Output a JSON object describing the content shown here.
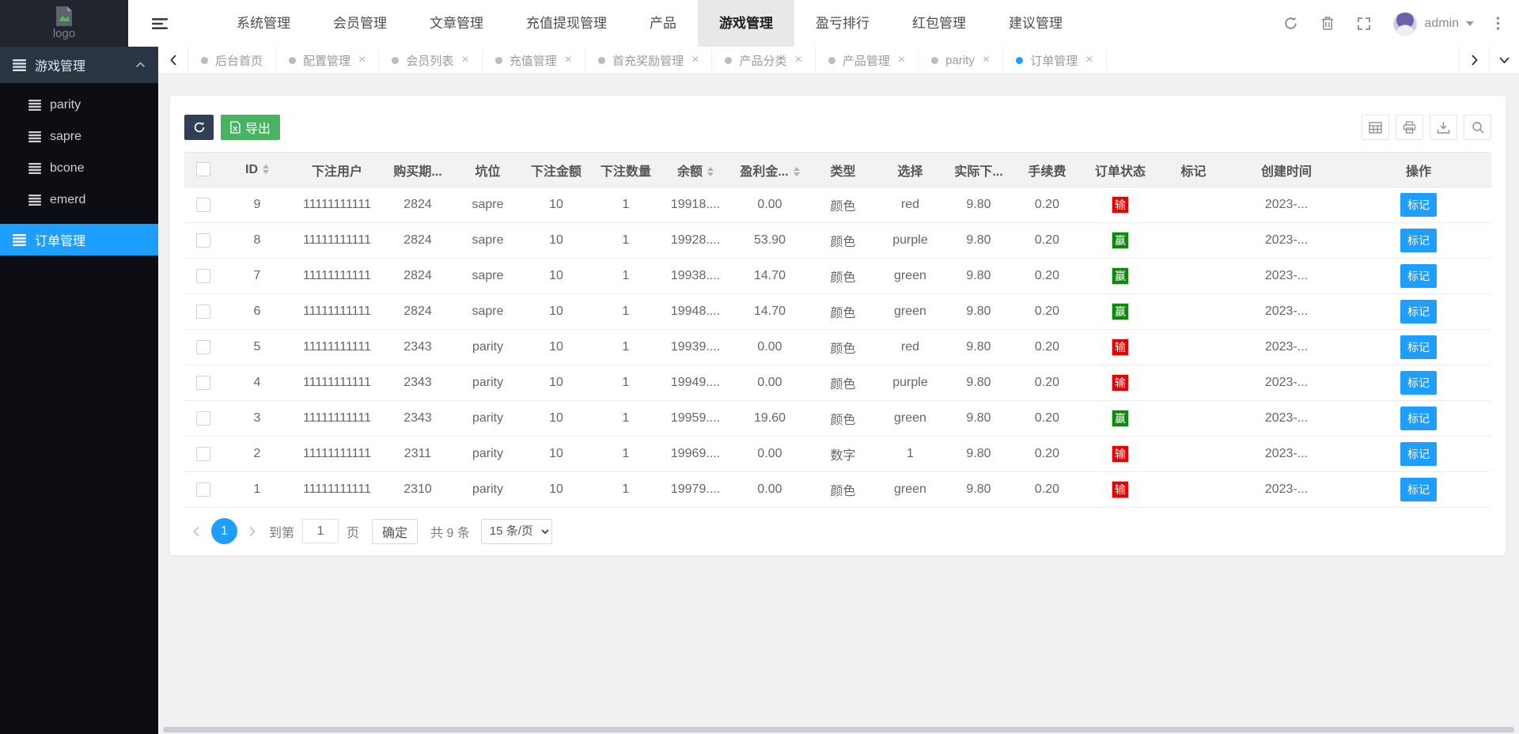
{
  "header": {
    "logo_text": "logo",
    "nav_items": [
      "系统管理",
      "会员管理",
      "文章管理",
      "充值提现管理",
      "产品",
      "游戏管理",
      "盈亏排行",
      "红包管理",
      "建议管理"
    ],
    "active_nav_index": 5,
    "username": "admin"
  },
  "tabbar": {
    "tabs": [
      {
        "label": "后台首页",
        "closable": false,
        "active": false
      },
      {
        "label": "配置管理",
        "closable": true,
        "active": false
      },
      {
        "label": "会员列表",
        "closable": true,
        "active": false
      },
      {
        "label": "充值管理",
        "closable": true,
        "active": false
      },
      {
        "label": "首充奖励管理",
        "closable": true,
        "active": false
      },
      {
        "label": "产品分类",
        "closable": true,
        "active": false
      },
      {
        "label": "产品管理",
        "closable": true,
        "active": false
      },
      {
        "label": "parity",
        "closable": true,
        "active": false
      },
      {
        "label": "订单管理",
        "closable": true,
        "active": true
      }
    ]
  },
  "sidebar": {
    "group_label": "游戏管理",
    "items": [
      "parity",
      "sapre",
      "bcone",
      "emerd"
    ],
    "active_item": "订单管理"
  },
  "toolbar": {
    "export_label": "导出"
  },
  "table": {
    "columns": [
      {
        "label": "ID",
        "sortable": true
      },
      {
        "label": "下注用户",
        "sortable": false
      },
      {
        "label": "购买期...",
        "sortable": false
      },
      {
        "label": "坑位",
        "sortable": false
      },
      {
        "label": "下注金额",
        "sortable": false
      },
      {
        "label": "下注数量",
        "sortable": false
      },
      {
        "label": "余额",
        "sortable": true
      },
      {
        "label": "盈利金...",
        "sortable": true
      },
      {
        "label": "类型",
        "sortable": false
      },
      {
        "label": "选择",
        "sortable": false
      },
      {
        "label": "实际下...",
        "sortable": false
      },
      {
        "label": "手续费",
        "sortable": false
      },
      {
        "label": "订单状态",
        "sortable": false
      },
      {
        "label": "标记",
        "sortable": false
      },
      {
        "label": "创建时间",
        "sortable": false
      },
      {
        "label": "操作",
        "sortable": false
      }
    ],
    "action_label": "标记",
    "rows": [
      {
        "id": "9",
        "user": "11111111111",
        "period": "2824",
        "slot": "sapre",
        "amount": "10",
        "qty": "1",
        "balance": "19918....",
        "profit": "0.00",
        "type": "颜色",
        "choice": "red",
        "actual": "9.80",
        "fee": "0.20",
        "status": "输",
        "status_type": "lose",
        "mark": "",
        "created": "2023-..."
      },
      {
        "id": "8",
        "user": "11111111111",
        "period": "2824",
        "slot": "sapre",
        "amount": "10",
        "qty": "1",
        "balance": "19928....",
        "profit": "53.90",
        "type": "颜色",
        "choice": "purple",
        "actual": "9.80",
        "fee": "0.20",
        "status": "赢",
        "status_type": "win",
        "mark": "",
        "created": "2023-..."
      },
      {
        "id": "7",
        "user": "11111111111",
        "period": "2824",
        "slot": "sapre",
        "amount": "10",
        "qty": "1",
        "balance": "19938....",
        "profit": "14.70",
        "type": "颜色",
        "choice": "green",
        "actual": "9.80",
        "fee": "0.20",
        "status": "赢",
        "status_type": "win",
        "mark": "",
        "created": "2023-..."
      },
      {
        "id": "6",
        "user": "11111111111",
        "period": "2824",
        "slot": "sapre",
        "amount": "10",
        "qty": "1",
        "balance": "19948....",
        "profit": "14.70",
        "type": "颜色",
        "choice": "green",
        "actual": "9.80",
        "fee": "0.20",
        "status": "赢",
        "status_type": "win",
        "mark": "",
        "created": "2023-..."
      },
      {
        "id": "5",
        "user": "11111111111",
        "period": "2343",
        "slot": "parity",
        "amount": "10",
        "qty": "1",
        "balance": "19939....",
        "profit": "0.00",
        "type": "颜色",
        "choice": "red",
        "actual": "9.80",
        "fee": "0.20",
        "status": "输",
        "status_type": "lose",
        "mark": "",
        "created": "2023-..."
      },
      {
        "id": "4",
        "user": "11111111111",
        "period": "2343",
        "slot": "parity",
        "amount": "10",
        "qty": "1",
        "balance": "19949....",
        "profit": "0.00",
        "type": "颜色",
        "choice": "purple",
        "actual": "9.80",
        "fee": "0.20",
        "status": "输",
        "status_type": "lose",
        "mark": "",
        "created": "2023-..."
      },
      {
        "id": "3",
        "user": "11111111111",
        "period": "2343",
        "slot": "parity",
        "amount": "10",
        "qty": "1",
        "balance": "19959....",
        "profit": "19.60",
        "type": "颜色",
        "choice": "green",
        "actual": "9.80",
        "fee": "0.20",
        "status": "赢",
        "status_type": "win",
        "mark": "",
        "created": "2023-..."
      },
      {
        "id": "2",
        "user": "11111111111",
        "period": "2311",
        "slot": "parity",
        "amount": "10",
        "qty": "1",
        "balance": "19969....",
        "profit": "0.00",
        "type": "数字",
        "choice": "1",
        "actual": "9.80",
        "fee": "0.20",
        "status": "输",
        "status_type": "lose",
        "mark": "",
        "created": "2023-..."
      },
      {
        "id": "1",
        "user": "11111111111",
        "period": "2310",
        "slot": "parity",
        "amount": "10",
        "qty": "1",
        "balance": "19979....",
        "profit": "0.00",
        "type": "颜色",
        "choice": "green",
        "actual": "9.80",
        "fee": "0.20",
        "status": "输",
        "status_type": "lose",
        "mark": "",
        "created": "2023-..."
      }
    ]
  },
  "pagination": {
    "current_page": "1",
    "goto_prefix": "到第",
    "goto_value": "1",
    "goto_suffix": "页",
    "confirm_label": "确定",
    "total_label": "共 9 条",
    "page_size_label": "15 条/页"
  },
  "colors": {
    "accent_blue": "#1e9fff",
    "export_green": "#48b462",
    "toolbar_dark": "#2f4056",
    "win_green": "#0b8a0b",
    "lose_red": "#e60000",
    "sidebar_dark": "#0c0e14",
    "sidebar_group": "#2a3544"
  }
}
